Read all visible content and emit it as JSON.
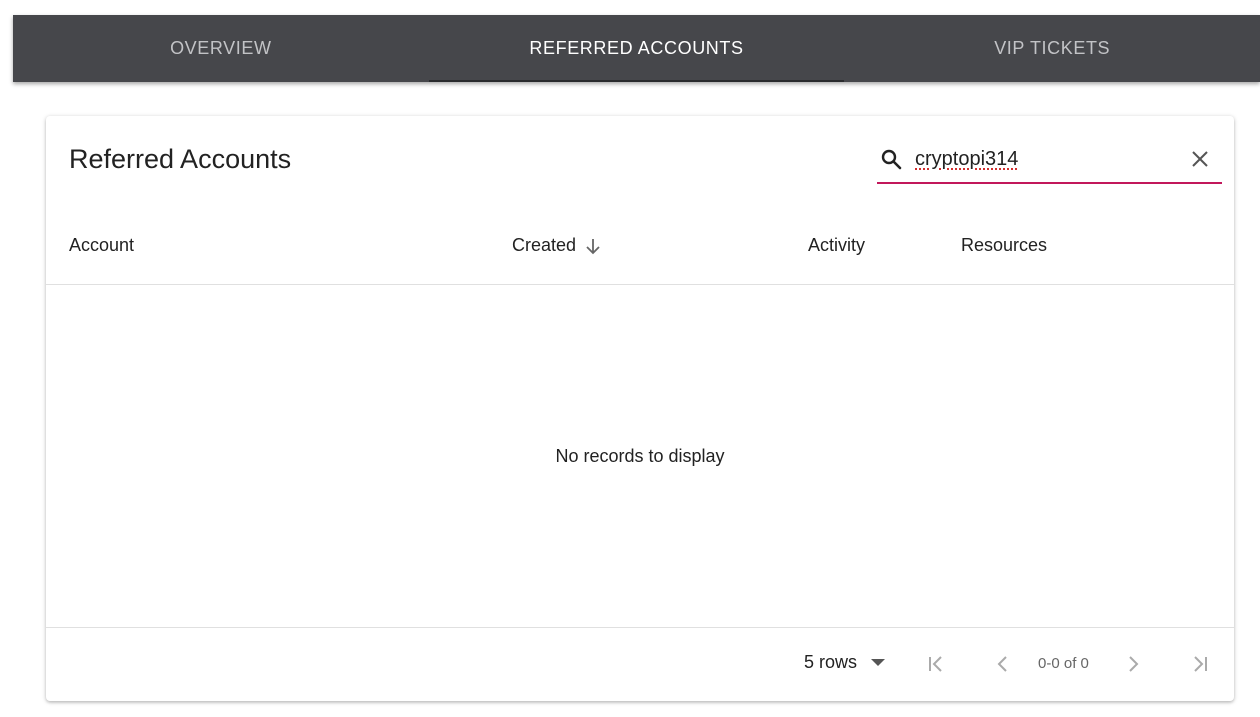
{
  "tabs": [
    {
      "label": "OVERVIEW",
      "active": false
    },
    {
      "label": "REFERRED ACCOUNTS",
      "active": true
    },
    {
      "label": "VIP TICKETS",
      "active": false
    }
  ],
  "card": {
    "title": "Referred Accounts",
    "search": {
      "value": "cryptopi314",
      "icon": "search-icon",
      "clear_icon": "close-icon",
      "underline_color": "#c2185b"
    }
  },
  "table": {
    "columns": [
      "Account",
      "Created",
      "Activity",
      "Resources"
    ],
    "sorted_column": "Created",
    "sort_direction": "descending",
    "empty_message": "No records to display"
  },
  "pagination": {
    "rows_label": "5 rows",
    "range_text": "0-0 of 0"
  },
  "colors": {
    "tabbar_bg": "#46474b",
    "accent": "#c2185b"
  }
}
